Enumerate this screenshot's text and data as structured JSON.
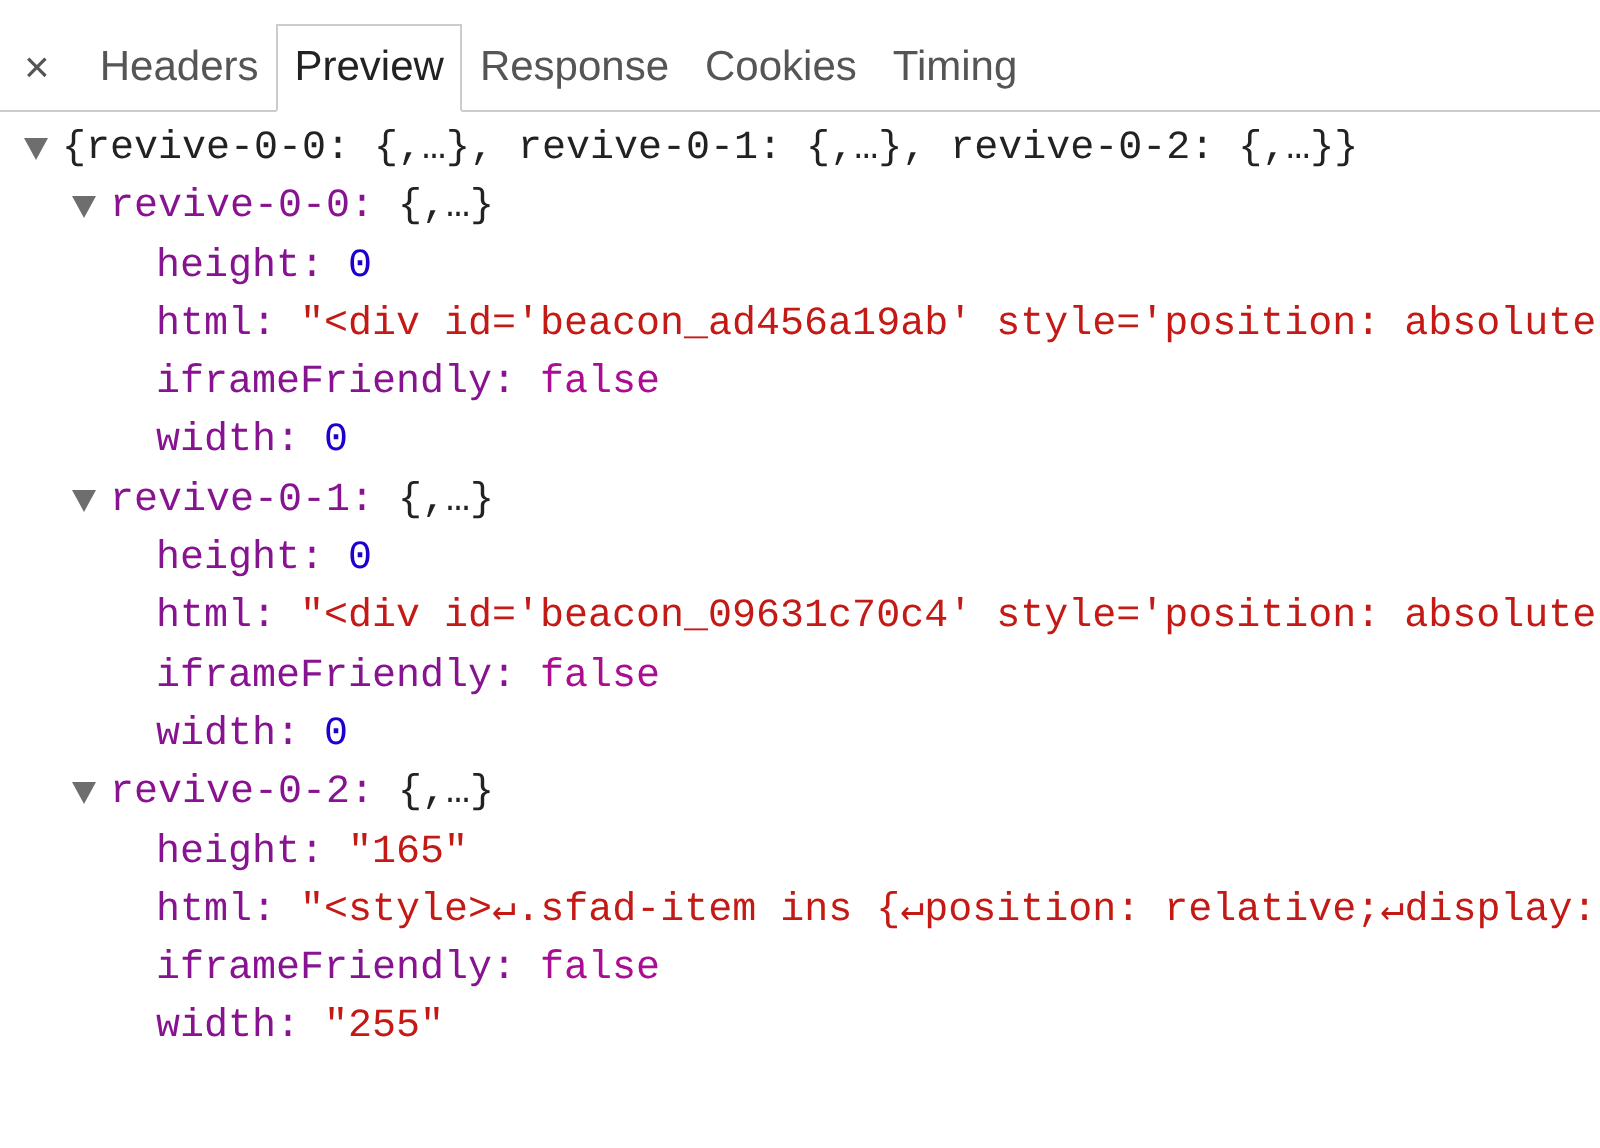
{
  "close_button": "×",
  "tabs": [
    {
      "label": "Headers",
      "selected": false
    },
    {
      "label": "Preview",
      "selected": true
    },
    {
      "label": "Response",
      "selected": false
    },
    {
      "label": "Cookies",
      "selected": false
    },
    {
      "label": "Timing",
      "selected": false
    }
  ],
  "tree": {
    "summary": "{revive-0-0: {,…}, revive-0-1: {,…}, revive-0-2: {,…}}",
    "expanded": true,
    "children": [
      {
        "key": "revive-0-0:",
        "summary": "{,…}",
        "expanded": true,
        "children": [
          {
            "key": "height:",
            "value": "0",
            "kind": "number"
          },
          {
            "key": "html:",
            "value": "\"<div id='beacon_ad456a19ab' style='position: absolute",
            "kind": "string"
          },
          {
            "key": "iframeFriendly:",
            "value": "false",
            "kind": "boolean"
          },
          {
            "key": "width:",
            "value": "0",
            "kind": "number"
          }
        ]
      },
      {
        "key": "revive-0-1:",
        "summary": "{,…}",
        "expanded": true,
        "children": [
          {
            "key": "height:",
            "value": "0",
            "kind": "number"
          },
          {
            "key": "html:",
            "value": "\"<div id='beacon_09631c70c4' style='position: absolute",
            "kind": "string"
          },
          {
            "key": "iframeFriendly:",
            "value": "false",
            "kind": "boolean"
          },
          {
            "key": "width:",
            "value": "0",
            "kind": "number"
          }
        ]
      },
      {
        "key": "revive-0-2:",
        "summary": "{,…}",
        "expanded": true,
        "children": [
          {
            "key": "height:",
            "value": "\"165\"",
            "kind": "string"
          },
          {
            "key": "html:",
            "value": "\"<style>↵.sfad-item ins {↵position: relative;↵display:",
            "kind": "string"
          },
          {
            "key": "iframeFriendly:",
            "value": "false",
            "kind": "boolean"
          },
          {
            "key": "width:",
            "value": "\"255\"",
            "kind": "string"
          }
        ]
      }
    ]
  }
}
